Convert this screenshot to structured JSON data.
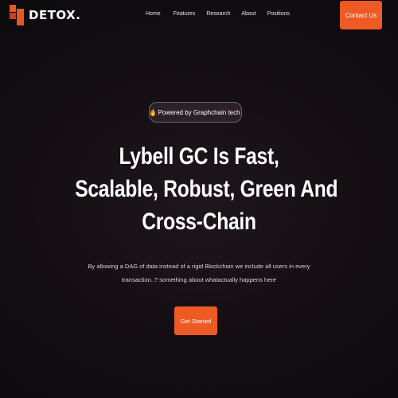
{
  "header": {
    "logo_text": "DETOX.",
    "nav": [
      "Home",
      "Features",
      "Research",
      "About",
      "Positions"
    ],
    "contact_label": "Contact Us"
  },
  "hero": {
    "badge_icon": "fire-icon",
    "badge_text": "Powered by Graphchain tech",
    "headline_lines": [
      "Lybell GC Is Fast,",
      "Scalable, Robust, Green And",
      "Cross-Chain"
    ],
    "subtext_lines": [
      "By allowing a DAG of data instead of a rigid Blockchain we include all users in every",
      "transaction..? something about whatactually happens here"
    ],
    "cta_label": "Get Started"
  },
  "colors": {
    "accent": "#ee5a24",
    "background": "#0c0a0d"
  }
}
